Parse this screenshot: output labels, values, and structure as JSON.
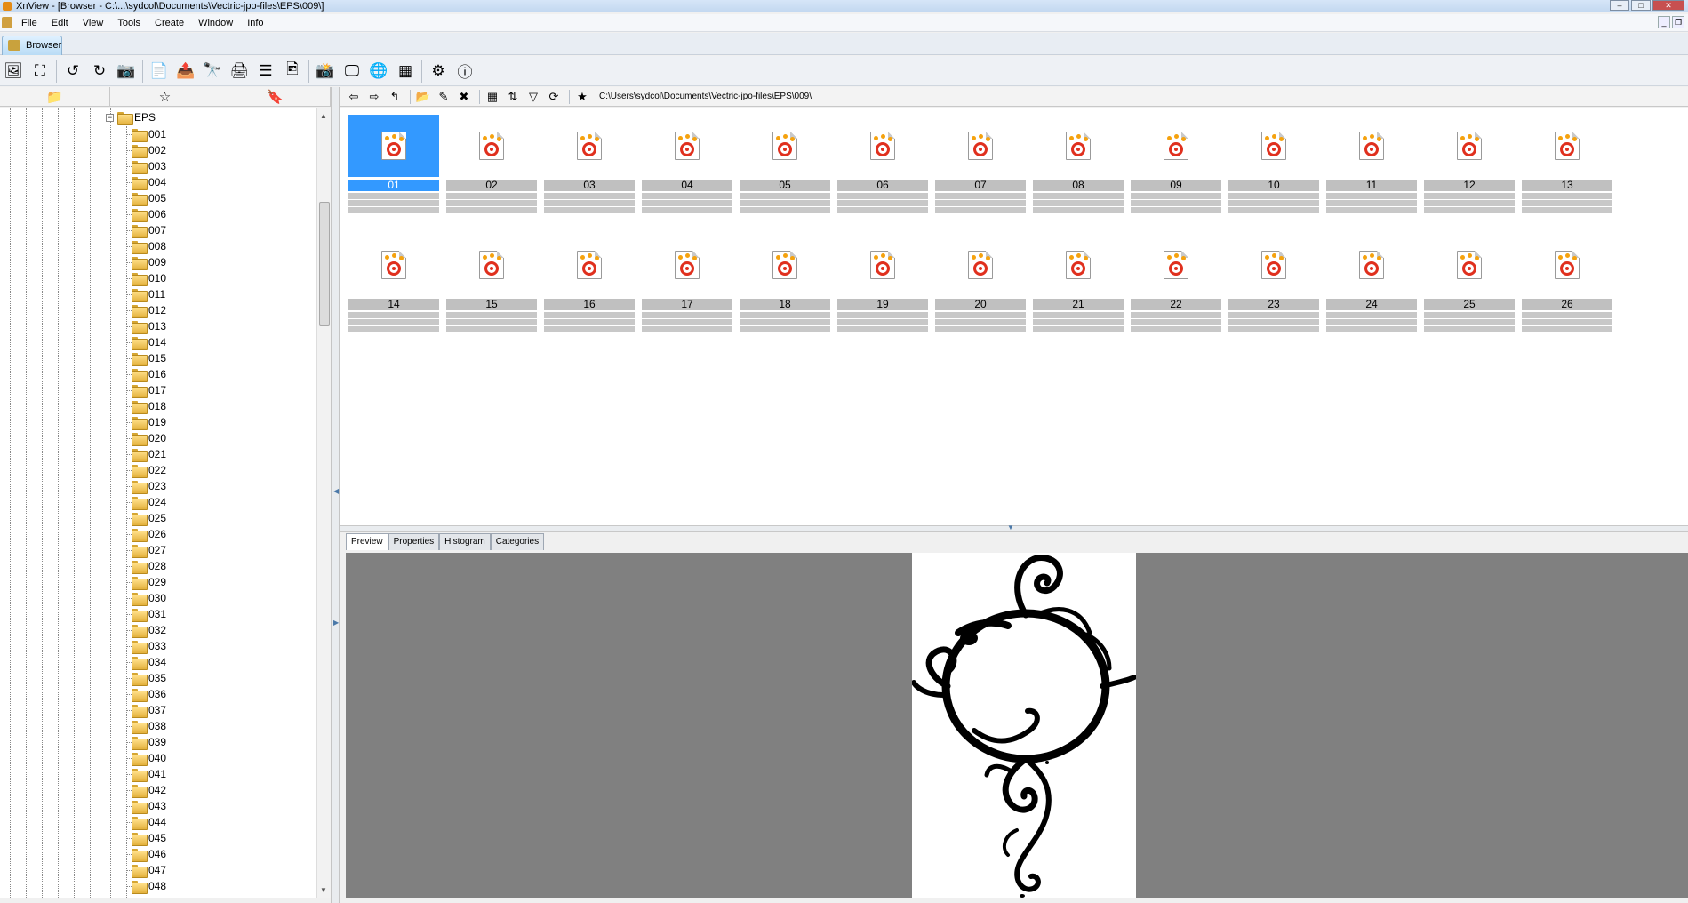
{
  "window": {
    "title": "XnView - [Browser - C:\\...\\sydcol\\Documents\\Vectric-jpo-files\\EPS\\009\\]",
    "controls": [
      "–",
      "□",
      "✕"
    ]
  },
  "menu": {
    "items": [
      "File",
      "Edit",
      "View",
      "Tools",
      "Create",
      "Window",
      "Info"
    ],
    "mdi_controls": [
      "_",
      "❐"
    ]
  },
  "tabs": {
    "browser": "Browser"
  },
  "toolbar": {
    "buttons": [
      {
        "name": "open-icon",
        "glyph": "🖼"
      },
      {
        "name": "fullscreen-icon",
        "glyph": "⛶"
      },
      {
        "name": "rotate-left-icon",
        "glyph": "↺"
      },
      {
        "name": "rotate-right-icon",
        "glyph": "↻"
      },
      {
        "name": "acquire-icon",
        "glyph": "📷"
      },
      {
        "name": "convert-icon",
        "glyph": "📄"
      },
      {
        "name": "export-icon",
        "glyph": "📤"
      },
      {
        "name": "find-icon",
        "glyph": "🔭"
      },
      {
        "name": "print-icon",
        "glyph": "🖨"
      },
      {
        "name": "scan-icon",
        "glyph": "☰"
      },
      {
        "name": "slideshow-icon",
        "glyph": "🖻"
      },
      {
        "name": "capture-icon",
        "glyph": "📸"
      },
      {
        "name": "wallpaper-icon",
        "glyph": "🖵"
      },
      {
        "name": "web-icon",
        "glyph": "🌐"
      },
      {
        "name": "grid-icon",
        "glyph": "▦"
      },
      {
        "name": "settings-icon",
        "glyph": "⚙"
      },
      {
        "name": "about-icon",
        "glyph": "ⓘ"
      }
    ]
  },
  "left_panel": {
    "tabs": [
      {
        "name": "folders-tab-icon",
        "glyph": "📁"
      },
      {
        "name": "favorites-tab-icon",
        "glyph": "☆"
      },
      {
        "name": "categories-tab-icon",
        "glyph": "🔖"
      }
    ],
    "root": {
      "label": "EPS",
      "expander": "−"
    },
    "folders": [
      "001",
      "002",
      "003",
      "004",
      "005",
      "006",
      "007",
      "008",
      "009",
      "010",
      "011",
      "012",
      "013",
      "014",
      "015",
      "016",
      "017",
      "018",
      "019",
      "020",
      "021",
      "022",
      "023",
      "024",
      "025",
      "026",
      "027",
      "028",
      "029",
      "030",
      "031",
      "032",
      "033",
      "034",
      "035",
      "036",
      "037",
      "038",
      "039",
      "040",
      "041",
      "042",
      "043",
      "044",
      "045",
      "046",
      "047",
      "048"
    ],
    "scroll": {
      "up": "▲",
      "down": "▼"
    }
  },
  "navbar": {
    "buttons": [
      {
        "name": "back-icon",
        "glyph": "⇦"
      },
      {
        "name": "forward-icon",
        "glyph": "⇨"
      },
      {
        "name": "up-folder-icon",
        "glyph": "↰"
      },
      {
        "name": "new-folder-icon",
        "glyph": "📂"
      },
      {
        "name": "rename-icon",
        "glyph": "✎"
      },
      {
        "name": "delete-icon",
        "glyph": "✖"
      },
      {
        "name": "view-mode-icon",
        "glyph": "▦"
      },
      {
        "name": "sort-icon",
        "glyph": "⇅"
      },
      {
        "name": "filter-icon",
        "glyph": "▽"
      },
      {
        "name": "refresh-icon",
        "glyph": "⟳"
      },
      {
        "name": "favorite-star-icon",
        "glyph": "★"
      }
    ],
    "path": "C:\\Users\\sydcol\\Documents\\Vectric-jpo-files\\EPS\\009\\"
  },
  "thumbnails": {
    "selected": "01",
    "items": [
      "01",
      "02",
      "03",
      "04",
      "05",
      "06",
      "07",
      "08",
      "09",
      "10",
      "11",
      "12",
      "13",
      "14",
      "15",
      "16",
      "17",
      "18",
      "19",
      "20",
      "21",
      "22",
      "23",
      "24",
      "25",
      "26"
    ]
  },
  "preview_tabs": [
    "Preview",
    "Properties",
    "Histogram",
    "Categories"
  ],
  "colors": {
    "selection": "#3399ff",
    "preview_background": "#808080",
    "label_background": "#c0c0c0"
  }
}
